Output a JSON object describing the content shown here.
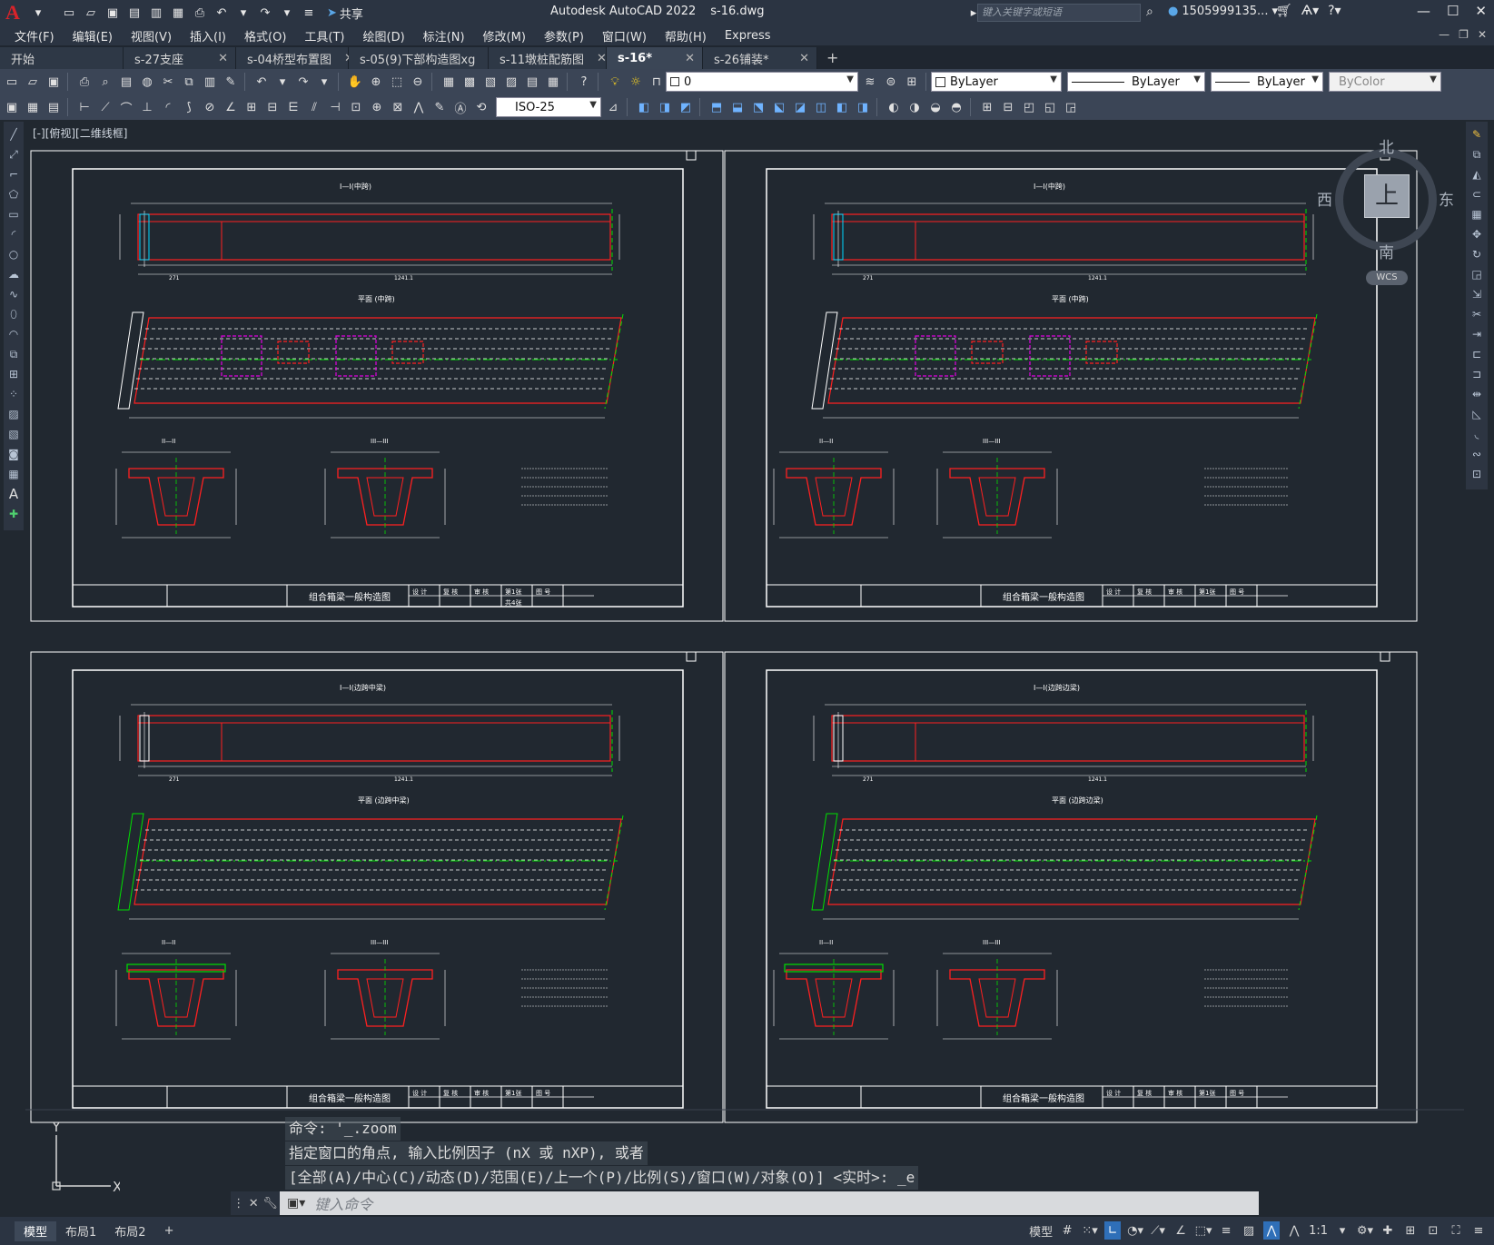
{
  "app": {
    "title": "Autodesk AutoCAD 2022",
    "filename": "s-16.dwg",
    "logo": "A",
    "search_placeholder": "键入关键字或短语",
    "user": "1505999135...",
    "share": "共享"
  },
  "menu": [
    "文件(F)",
    "编辑(E)",
    "视图(V)",
    "插入(I)",
    "格式(O)",
    "工具(T)",
    "绘图(D)",
    "标注(N)",
    "修改(M)",
    "参数(P)",
    "窗口(W)",
    "帮助(H)",
    "Express"
  ],
  "tabs": [
    {
      "label": "开始",
      "closable": false,
      "active": false
    },
    {
      "label": "s-27支座",
      "closable": true,
      "active": false
    },
    {
      "label": "s-04桥型布置图",
      "closable": true,
      "active": false
    },
    {
      "label": "s-05(9)下部构造图xg",
      "closable": true,
      "active": false
    },
    {
      "label": "s-11墩桩配筋图",
      "closable": true,
      "active": false
    },
    {
      "label": "s-16*",
      "closable": true,
      "active": true
    },
    {
      "label": "s-26铺装*",
      "closable": true,
      "active": false
    }
  ],
  "toolbar1": {
    "layer_value": "0",
    "color_value": "ByLayer",
    "linetype_value": "ByLayer",
    "lineweight_value": "ByLayer",
    "plotstyle_value": "ByColor"
  },
  "toolbar2": {
    "dimstyle_value": "ISO-25"
  },
  "viewport": {
    "label": "[-][俯视][二维线框]"
  },
  "viewcube": {
    "top": "上",
    "north": "北",
    "south": "南",
    "east": "东",
    "west": "西",
    "wcs": "WCS"
  },
  "ucs": {
    "x": "X",
    "y": "Y"
  },
  "sheets": [
    {
      "title": "组合箱梁一般构造图",
      "section1": "I—I(中跨)",
      "plan": "平面 (中跨)",
      "sec2": "II—II",
      "sec3": "III—III",
      "pages": "共4张"
    },
    {
      "title": "组合箱梁一般构造图",
      "section1": "I—I(中跨)",
      "plan": "平面 (中跨)",
      "sec2": "II—II",
      "sec3": "III—III",
      "pages": ""
    },
    {
      "title": "组合箱梁一般构造图",
      "section1": "I—I(边跨中梁)",
      "plan": "平面 (边跨中梁)",
      "sec2": "II—II",
      "sec3": "III—III",
      "pages": ""
    },
    {
      "title": "组合箱梁一般构造图",
      "section1": "I—I(边跨边梁)",
      "plan": "平面 (边跨边梁)",
      "sec2": "II—II",
      "sec3": "III—III",
      "pages": ""
    }
  ],
  "titleblock_cells": [
    "设 计",
    "复 核",
    "审 核",
    "第1张",
    "图 号"
  ],
  "command": {
    "history": [
      "命令: '_.zoom",
      "指定窗口的角点, 输入比例因子 (nX 或 nXP), 或者",
      "[全部(A)/中心(C)/动态(D)/范围(E)/上一个(P)/比例(S)/窗口(W)/对象(O)] <实时>: _e"
    ],
    "placeholder": "键入命令"
  },
  "layout_tabs": [
    {
      "label": "模型",
      "active": true
    },
    {
      "label": "布局1",
      "active": false
    },
    {
      "label": "布局2",
      "active": false
    }
  ],
  "status": {
    "model": "模型",
    "scale": "1:1"
  },
  "colors": {
    "accent_red": "#d8232a",
    "drawing_red": "#ff2020",
    "drawing_white": "#ffffff",
    "drawing_green": "#00e000",
    "drawing_cyan": "#00d8ff",
    "drawing_magenta": "#e000e0"
  }
}
